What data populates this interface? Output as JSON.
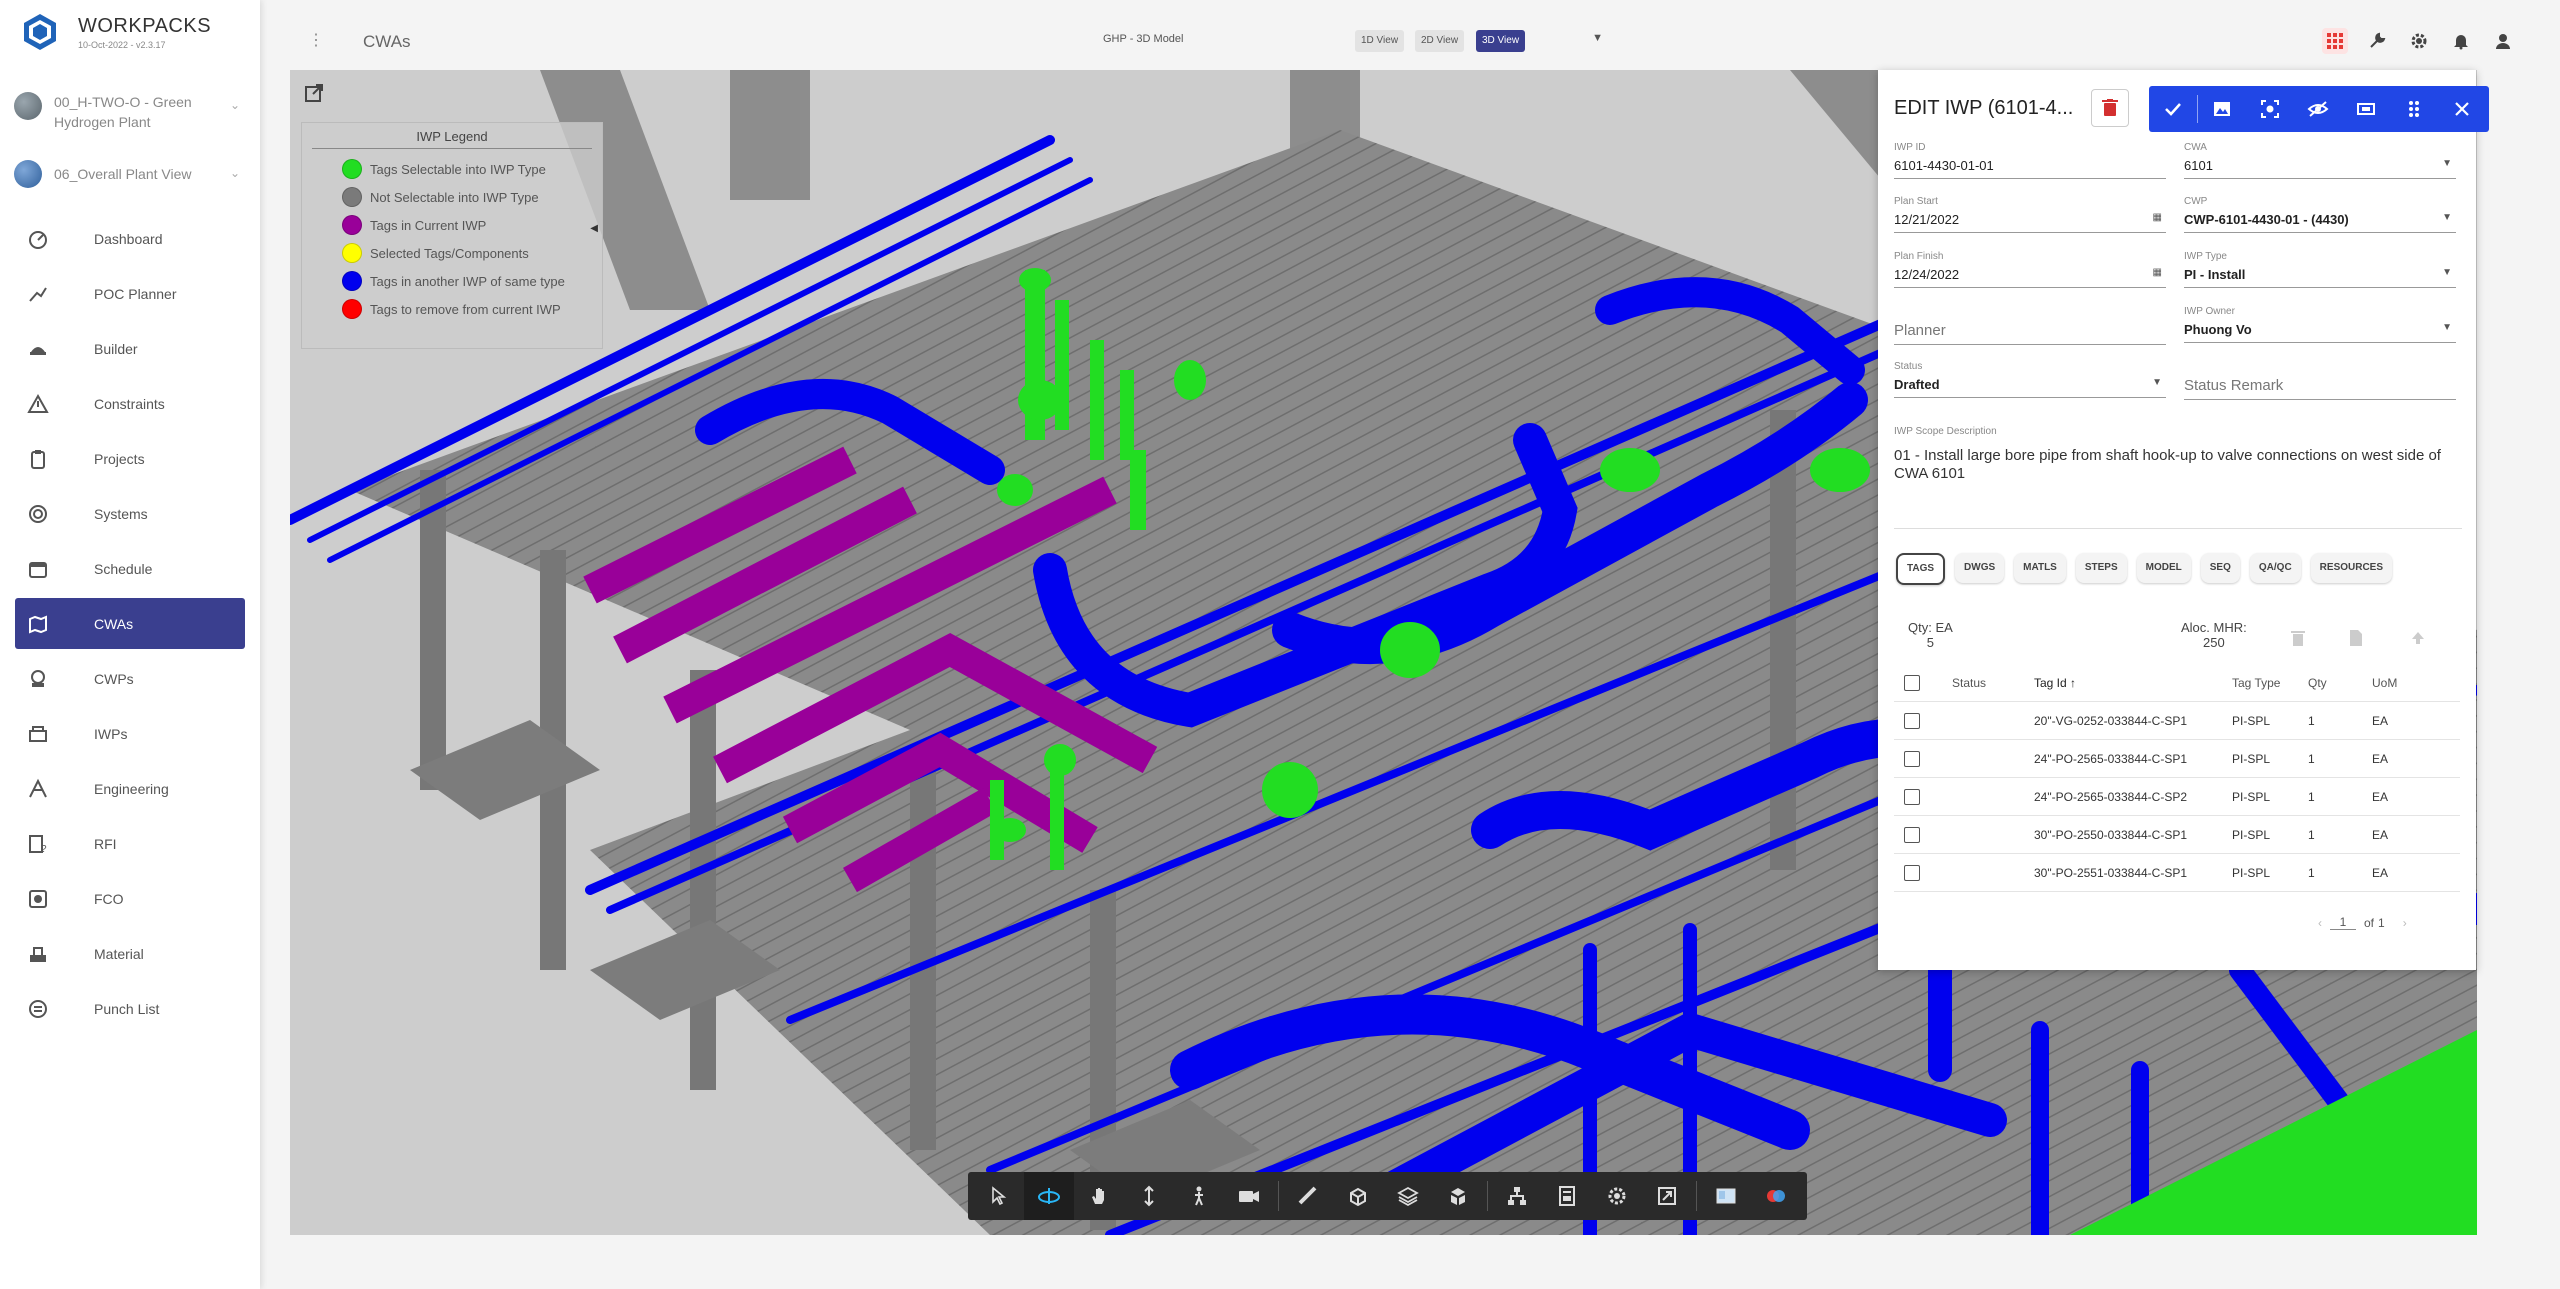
{
  "brand": {
    "name": "WORKPACKS",
    "subtitle": "10-Oct-2022 - v2.3.17"
  },
  "projects": [
    {
      "label": "00_H-TWO-O - Green Hydrogen Plant"
    },
    {
      "label": "06_Overall Plant View"
    }
  ],
  "sidebar": {
    "items": [
      {
        "label": "Dashboard",
        "icon": "dashboard-icon"
      },
      {
        "label": "POC Planner",
        "icon": "planner-icon"
      },
      {
        "label": "Builder",
        "icon": "builder-icon"
      },
      {
        "label": "Constraints",
        "icon": "warning-icon"
      },
      {
        "label": "Projects",
        "icon": "clipboard-icon"
      },
      {
        "label": "Systems",
        "icon": "target-icon"
      },
      {
        "label": "Schedule",
        "icon": "calendar-icon"
      },
      {
        "label": "CWAs",
        "icon": "map-icon"
      },
      {
        "label": "CWPs",
        "icon": "cwp-icon"
      },
      {
        "label": "IWPs",
        "icon": "iwp-icon"
      },
      {
        "label": "Engineering",
        "icon": "engineering-icon"
      },
      {
        "label": "RFI",
        "icon": "rfi-icon"
      },
      {
        "label": "FCO",
        "icon": "fco-icon"
      },
      {
        "label": "Material",
        "icon": "material-icon"
      },
      {
        "label": "Punch List",
        "icon": "punch-list-icon"
      }
    ],
    "active": "CWAs"
  },
  "header": {
    "title": "CWAs",
    "model_select": "GHP - 3D Model",
    "views": [
      "1D View",
      "2D View",
      "3D View"
    ],
    "active_view": "3D View"
  },
  "legend": {
    "title": "IWP Legend",
    "items": [
      {
        "label": "Tags Selectable into IWP Type",
        "color": "#22dd22"
      },
      {
        "label": "Not Selectable into IWP Type",
        "color": "#7a7a7a"
      },
      {
        "label": "Tags in Current IWP",
        "color": "#990099"
      },
      {
        "label": "Selected Tags/Components",
        "color": "#ffff00"
      },
      {
        "label": "Tags in another IWP of same type",
        "color": "#0000ee"
      },
      {
        "label": "Tags to remove from current IWP",
        "color": "#ff0000"
      }
    ]
  },
  "panel": {
    "title": "EDIT IWP (6101-4...",
    "fields": {
      "iwp_id": {
        "label": "IWP ID",
        "value": "6101-4430-01-01"
      },
      "cwa": {
        "label": "CWA",
        "value": "6101"
      },
      "plan_start": {
        "label": "Plan Start",
        "value": "12/21/2022"
      },
      "cwp": {
        "label": "CWP",
        "value": "CWP-6101-4430-01 - (4430)"
      },
      "plan_finish": {
        "label": "Plan Finish",
        "value": "12/24/2022"
      },
      "iwp_type": {
        "label": "IWP Type",
        "value": "PI - Install"
      },
      "planner": {
        "placeholder": "Planner"
      },
      "iwp_owner": {
        "label": "IWP Owner",
        "value": "Phuong Vo"
      },
      "status": {
        "label": "Status",
        "value": "Drafted"
      },
      "status_remark": {
        "placeholder": "Status Remark"
      }
    },
    "scope_label": "IWP Scope Description",
    "scope_text": "01 - Install large bore pipe from shaft hook-up to valve connections on west side of CWA 6101",
    "tabs": [
      "TAGS",
      "DWGS",
      "MATLS",
      "STEPS",
      "MODEL",
      "SEQ",
      "QA/QC",
      "RESOURCES"
    ],
    "active_tab": "TAGS",
    "qty_label": "Qty: EA",
    "qty_value": "5",
    "aloc_label": "Aloc. MHR:",
    "aloc_value": "250",
    "table": {
      "columns": [
        "Status",
        "Tag Id",
        "Tag Type",
        "Qty",
        "UoM"
      ],
      "sort_indicator": "↑",
      "rows": [
        {
          "status": "",
          "tag_id": "20\"-VG-0252-033844-C-SP1",
          "tag_type": "PI-SPL",
          "qty": "1",
          "uom": "EA"
        },
        {
          "status": "",
          "tag_id": "24\"-PO-2565-033844-C-SP1",
          "tag_type": "PI-SPL",
          "qty": "1",
          "uom": "EA"
        },
        {
          "status": "",
          "tag_id": "24\"-PO-2565-033844-C-SP2",
          "tag_type": "PI-SPL",
          "qty": "1",
          "uom": "EA"
        },
        {
          "status": "",
          "tag_id": "30\"-PO-2550-033844-C-SP1",
          "tag_type": "PI-SPL",
          "qty": "1",
          "uom": "EA"
        },
        {
          "status": "",
          "tag_id": "30\"-PO-2551-033844-C-SP1",
          "tag_type": "PI-SPL",
          "qty": "1",
          "uom": "EA"
        }
      ]
    },
    "pager": {
      "page": "1",
      "of_label": "of",
      "total": "1"
    }
  },
  "colors": {
    "accent": "#3a3f8f",
    "action_bar": "#2147e6",
    "delete": "#d32f2f",
    "pipe_blue": "#0000ee",
    "pipe_magenta": "#990099",
    "pipe_green": "#22dd22",
    "steel_grey": "#7a7a7a"
  }
}
